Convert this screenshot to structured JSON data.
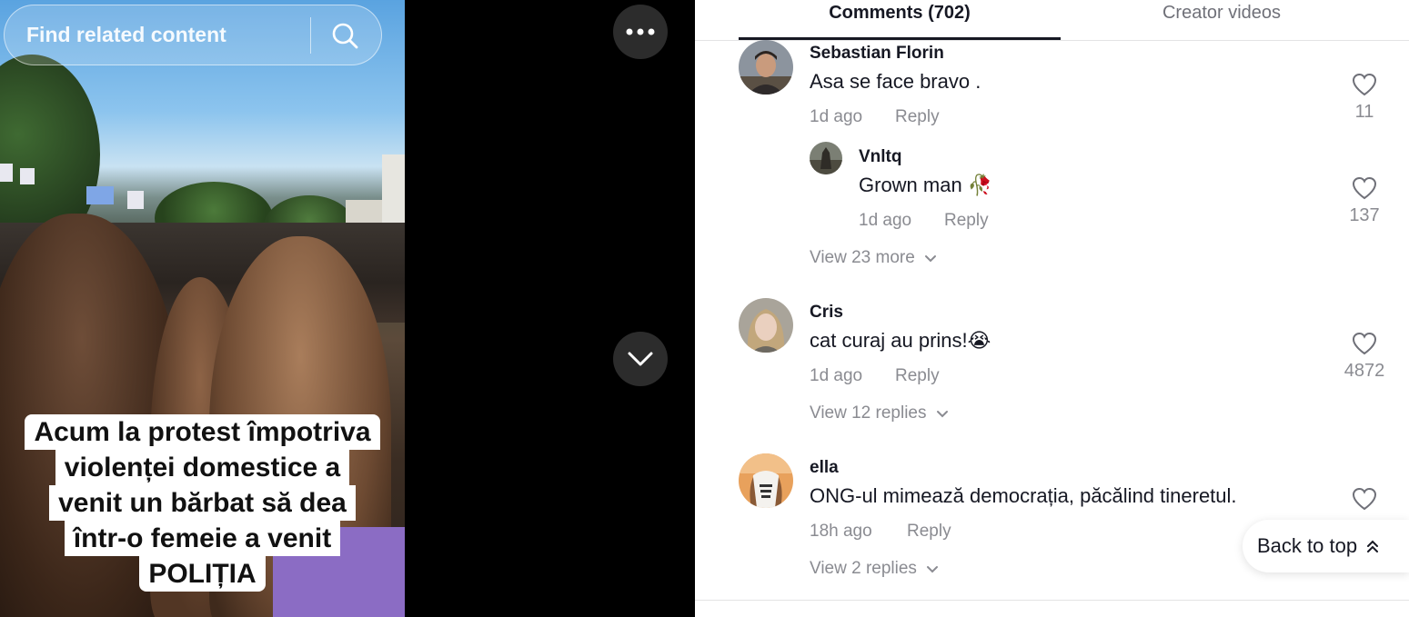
{
  "video": {
    "search_placeholder": "Find related content",
    "caption_lines": [
      "Acum la protest împotriva",
      "violenței domestice a",
      "venit un bărbat să dea",
      "într-o femeie a venit",
      "POLIȚIA"
    ]
  },
  "comments_panel": {
    "tabs": {
      "comments": "Comments (702)",
      "creator_videos": "Creator videos"
    },
    "comments": [
      {
        "username": "Sebastian Florin",
        "text": "Asa se face bravo .",
        "time": "1d ago",
        "reply_label": "Reply",
        "likes": "11"
      },
      {
        "username": "Vnltq",
        "text": "Grown man 🥀",
        "time": "1d ago",
        "reply_label": "Reply",
        "likes": "137",
        "view_more": "View 23 more"
      },
      {
        "username": "Cris",
        "text": "cat curaj au prins!😭",
        "time": "1d ago",
        "reply_label": "Reply",
        "likes": "4872",
        "view_more": "View 12 replies"
      },
      {
        "username": "ella",
        "text": "ONG-ul mimează democrația, păcălind tineretul.",
        "time": "18h ago",
        "reply_label": "Reply",
        "view_more": "View 2 replies"
      }
    ],
    "back_to_top": "Back to top"
  }
}
